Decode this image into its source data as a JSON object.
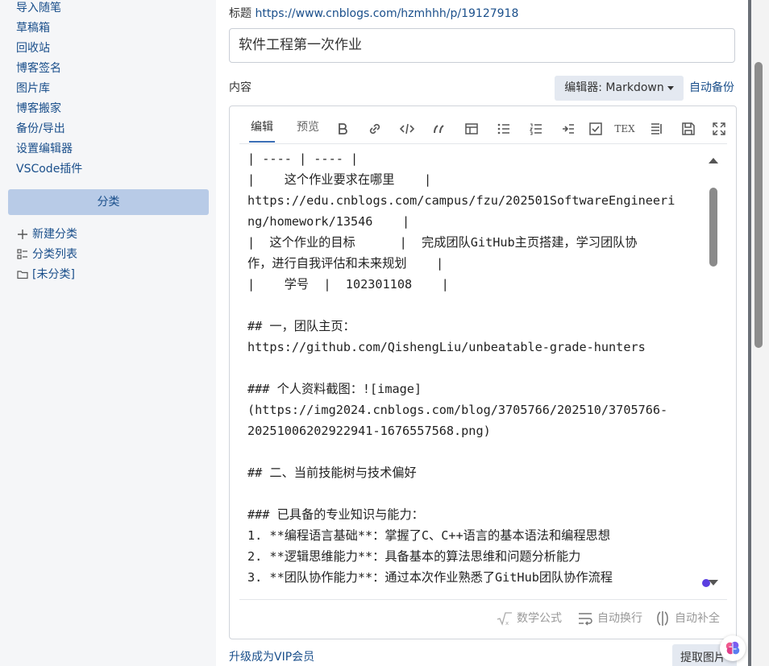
{
  "sidebar": {
    "nav_items": [
      {
        "label": "导入随笔"
      },
      {
        "label": "草稿箱"
      },
      {
        "label": "回收站"
      },
      {
        "label": "博客签名"
      },
      {
        "label": "图片库"
      },
      {
        "label": "博客搬家"
      },
      {
        "label": "备份/导出"
      },
      {
        "label": "设置编辑器"
      },
      {
        "label": "VSCode插件"
      }
    ],
    "category_header": "分类",
    "category_links": [
      {
        "label": "新建分类",
        "icon": "plus-icon"
      },
      {
        "label": "分类列表",
        "icon": "list-grid-icon"
      },
      {
        "label": "[未分类]",
        "icon": "folder-icon"
      }
    ]
  },
  "main": {
    "title_label": "标题",
    "title_url": "https://www.cnblogs.com/hzmhhh/p/19127918",
    "title_value": "软件工程第一次作业",
    "content_label": "内容",
    "editor_select": "编辑器: Markdown",
    "auto_backup": "自动备份",
    "tabs": [
      {
        "label": "编辑",
        "active": true
      },
      {
        "label": "预览",
        "active": false
      }
    ],
    "toolbar_icons": [
      "bold-icon",
      "link-icon",
      "code-icon",
      "quote-icon",
      "table-icon",
      "bullet-list-icon",
      "ordered-list-icon",
      "indent-icon",
      "checkbox-icon",
      "tex-icon",
      "toc-icon",
      "save-icon",
      "fullscreen-icon"
    ],
    "tex_label": "TEX",
    "code_lines": [
      "| ---- | ---- |",
      "|    这个作业要求在哪里    |",
      "https://edu.cnblogs.com/campus/fzu/202501SoftwareEngineeri",
      "ng/homework/13546    |",
      "|  这个作业的目标      |  完成团队GitHub主页搭建，学习团队协",
      "作，进行自我评估和未来规划    |",
      "|    学号  |  102301108    |",
      "",
      "## 一，团队主页：",
      "https://github.com/QishengLiu/unbeatable-grade-hunters",
      "",
      "### 个人资料截图：![image]",
      "(https://img2024.cnblogs.com/blog/3705766/202510/3705766-",
      "20251006202922941-1676557568.png)",
      "",
      "## 二、当前技能树与技术偏好",
      "",
      "### 已具备的专业知识与能力：",
      "1. **编程语言基础**：掌握了C、C++语言的基本语法和编程思想",
      "2. **逻辑思维能力**：具备基本的算法思维和问题分析能力",
      "3. **团队协作能力**：通过本次作业熟悉了GitHub团队协作流程"
    ],
    "footer_options": [
      {
        "label": "数学公式",
        "icon": "sqrt-icon"
      },
      {
        "label": "自动换行",
        "icon": "wrap-icon"
      },
      {
        "label": "自动补全",
        "icon": "autocomplete-icon"
      }
    ],
    "vip_link": "升级成为VIP会员",
    "extract_button": "提取图片"
  },
  "colors": {
    "link": "#1a4f8b",
    "sidebar_bg": "#f5f6f8",
    "category_bar": "#b8cbe7",
    "select_bg": "#e4e9f1",
    "tab_underline": "#3b6fb6"
  }
}
